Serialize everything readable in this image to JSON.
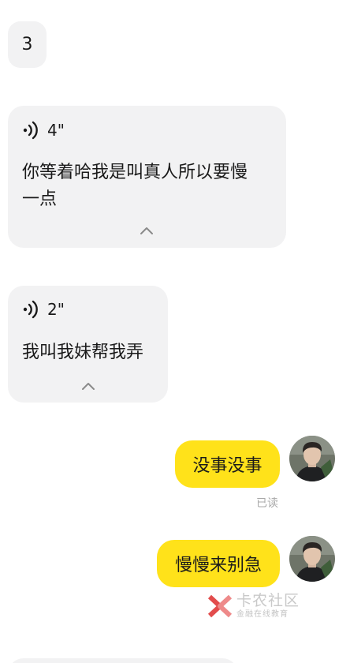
{
  "messages": {
    "m1": {
      "text": "3"
    },
    "m2": {
      "duration": "4\"",
      "transcript_line1": "你等着哈我是叫真人所以要慢",
      "transcript_line2": "一点"
    },
    "m3": {
      "duration": "2\"",
      "transcript": "我叫我妹帮我弄"
    },
    "m4": {
      "text": "没事没事",
      "status": "已读"
    },
    "m5": {
      "text": "慢慢来别急"
    }
  },
  "watermark": {
    "title": "卡农社区",
    "subtitle": "金融在线教育"
  },
  "colors": {
    "incoming_bubble": "#f2f2f3",
    "outgoing_bubble": "#ffe21a",
    "read_status": "#a8a8a8",
    "watermark_red": "#e24c4c"
  },
  "icons": {
    "voice": "voice-wave-icon",
    "expand": "chevron-up-icon"
  }
}
